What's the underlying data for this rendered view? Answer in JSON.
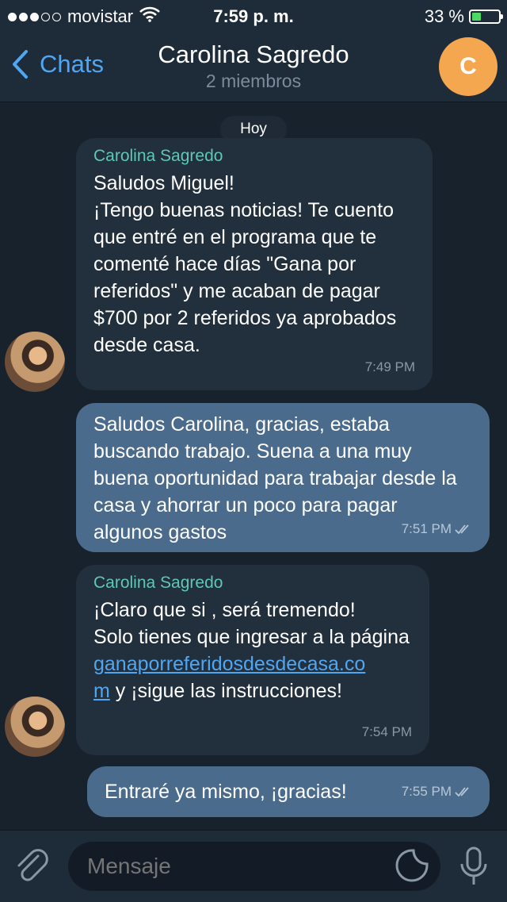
{
  "status_bar": {
    "carrier": "movistar",
    "time": "7:59 p. m.",
    "battery": "33 %",
    "battery_level": 0.33,
    "signal_bars_filled": 3,
    "signal_bars_total": 5
  },
  "header": {
    "back_label": "Chats",
    "title": "Carolina Sagredo",
    "subtitle": "2 miembros",
    "avatar_letter": "C",
    "avatar_color": "#f5a74f"
  },
  "date_chip": "Hoy",
  "messages": [
    {
      "sender": "Carolina Sagredo",
      "text": "Saludos Miguel!\n¡Tengo buenas noticias! Te cuento que entré en el programa que te comenté hace días  \"Gana por referidos\" y me acaban de pagar $700 por 2 referidos ya aprobados desde casa.",
      "time": "7:49 PM"
    },
    {
      "text": "Saludos Carolina, gracias, estaba buscando trabajo. Suena a una muy buena oportunidad para trabajar desde la casa y ahorrar un poco para pagar  algunos gastos",
      "time": "7:51 PM"
    },
    {
      "sender": "Carolina Sagredo",
      "text_before": "¡Claro que si , será tremendo!\nSolo tienes que ingresar a la página\n",
      "link": "ganaporreferidosdesdecasa.co\nm",
      "text_after": " y ¡sigue las instrucciones!",
      "time": "7:54 PM"
    },
    {
      "text": "Entraré ya mismo, ¡gracias!",
      "time": "7:55 PM"
    }
  ],
  "input": {
    "placeholder": "Mensaje"
  },
  "colors": {
    "background": "#18222d",
    "incoming_bubble": "#222f3c",
    "outgoing_bubble": "#4b6b8c",
    "accent": "#4fa6f2",
    "sender_name": "#5ec8b7"
  }
}
